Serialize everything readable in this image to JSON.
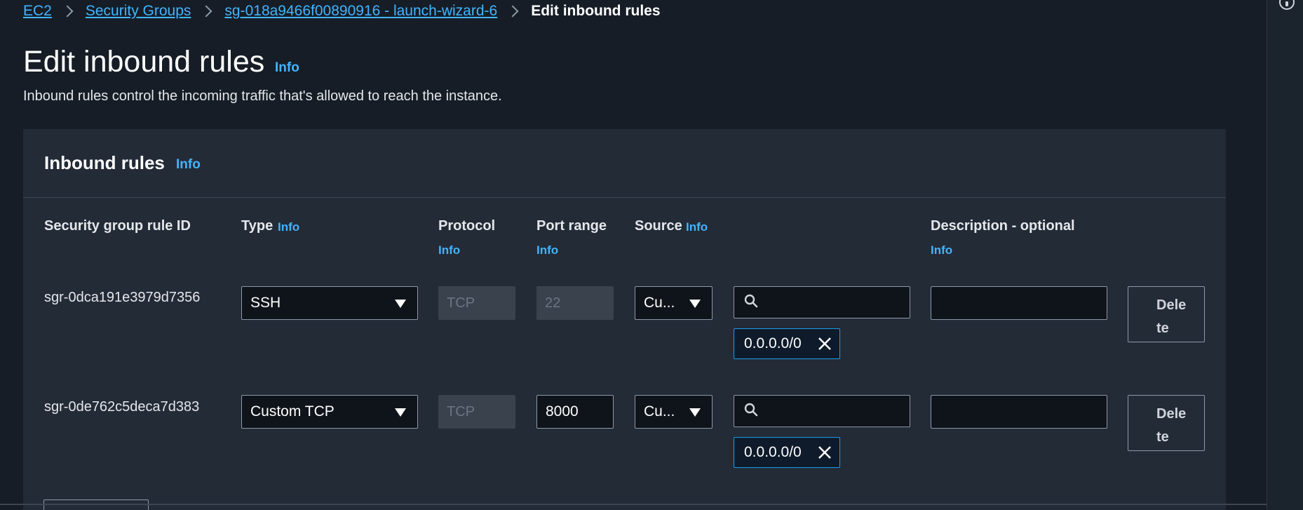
{
  "breadcrumb": {
    "items": [
      "EC2",
      "Security Groups",
      "sg-018a9466f00890916 - launch-wizard-6"
    ],
    "current": "Edit inbound rules"
  },
  "page": {
    "title": "Edit inbound rules",
    "info": "Info",
    "description": "Inbound rules control the incoming traffic that's allowed to reach the instance."
  },
  "panel": {
    "title": "Inbound rules",
    "info": "Info"
  },
  "columns": {
    "rule_id": "Security group rule ID",
    "type": "Type",
    "type_info": "Info",
    "protocol": "Protocol",
    "protocol_info": "Info",
    "port_range": "Port range",
    "port_range_info": "Info",
    "source": "Source",
    "source_info": "Info",
    "description": "Description - optional",
    "description_info": "Info"
  },
  "rules": [
    {
      "id": "sgr-0dca191e3979d7356",
      "type": "SSH",
      "protocol": "TCP",
      "port_range": "22",
      "source_type": "Cu...",
      "source_token": "0.0.0.0/0",
      "description": "",
      "delete_label_1": "Dele",
      "delete_label_2": "te"
    },
    {
      "id": "sgr-0de762c5deca7d383",
      "type": "Custom TCP",
      "protocol": "TCP",
      "port_range": "8000",
      "source_type": "Cu...",
      "source_token": "0.0.0.0/0",
      "description": "",
      "delete_label_1": "Dele",
      "delete_label_2": "te"
    }
  ],
  "colors": {
    "background": "#161d26",
    "panel": "#232b37",
    "link": "#42b4ff",
    "token_border": "#1a9ee8"
  }
}
